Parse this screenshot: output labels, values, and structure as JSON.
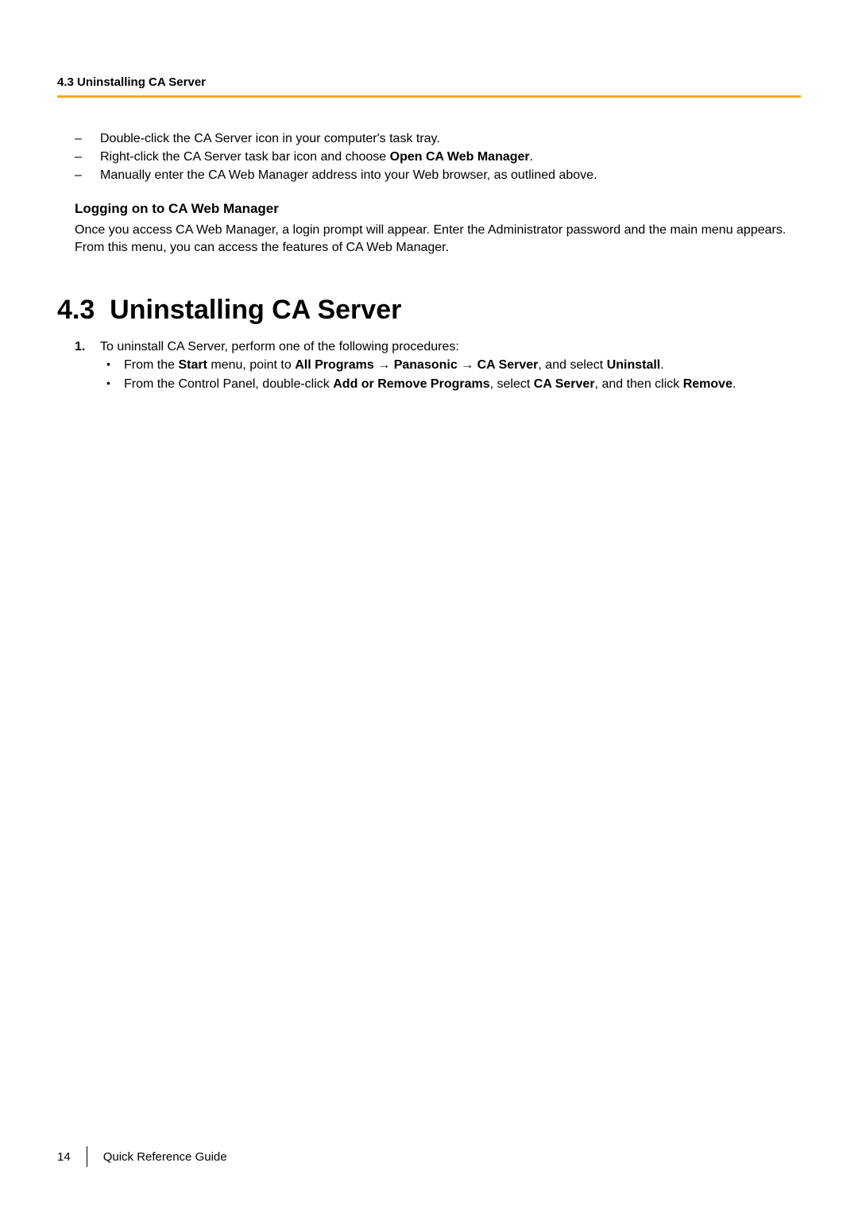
{
  "header": {
    "title": "4.3 Uninstalling CA Server"
  },
  "dashItems": {
    "item1": "Double-click the CA Server icon in your computer's task tray.",
    "item2_pre": "Right-click the CA Server task bar icon and choose ",
    "item2_bold": "Open CA Web Manager",
    "item2_post": ".",
    "item3": "Manually enter the CA Web Manager address into your Web browser, as outlined above."
  },
  "subsection": {
    "title": "Logging on to CA Web Manager",
    "text": "Once you access CA Web Manager, a login prompt will appear. Enter the Administrator password and the main menu appears. From this menu, you can access the features of CA Web Manager."
  },
  "mainHeading": {
    "number": "4.3",
    "title": "Uninstalling CA Server"
  },
  "procedure": {
    "marker": "1.",
    "intro": "To uninstall CA Server, perform one of the following procedures:",
    "bullet1": {
      "p1": "From the ",
      "b1": "Start",
      "p2": " menu, point to ",
      "b2": "All Programs",
      "arrow1": " → ",
      "b3": "Panasonic",
      "arrow2": " → ",
      "b4": "CA Server",
      "p3": ", and select ",
      "b5": "Uninstall",
      "p4": "."
    },
    "bullet2": {
      "p1": "From the Control Panel, double-click ",
      "b1": "Add or Remove Programs",
      "p2": ", select ",
      "b2": "CA Server",
      "p3": ", and then click ",
      "b3": "Remove",
      "p4": "."
    }
  },
  "footer": {
    "pageNumber": "14",
    "title": "Quick Reference Guide"
  }
}
